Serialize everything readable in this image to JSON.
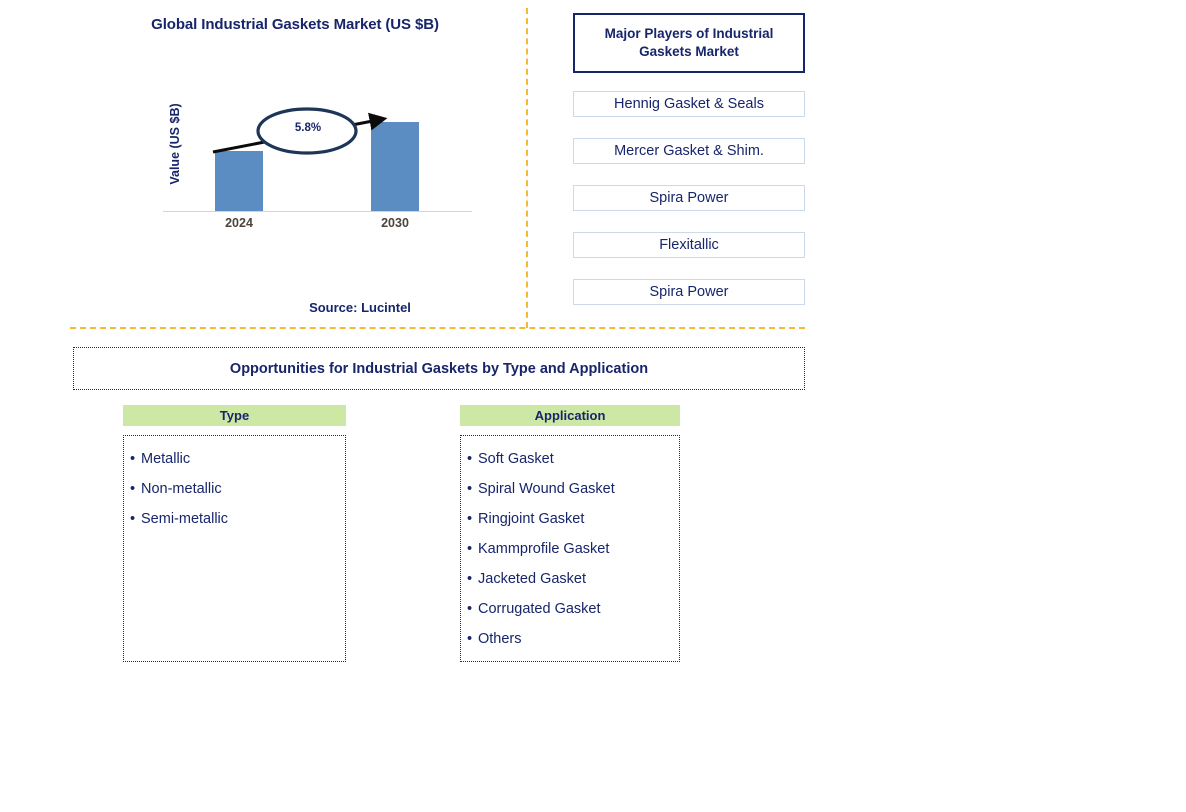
{
  "chart_panel": {
    "title": "Global Industrial Gaskets Market (US $B)",
    "ylabel": "Value (US $B)",
    "cagr_label": "5.8%",
    "source": "Source: Lucintel"
  },
  "chart_data": {
    "type": "bar",
    "title": "Global Industrial Gaskets Market (US $B)",
    "categories": [
      "2024",
      "2030"
    ],
    "values": [
      60,
      89
    ],
    "xlabel": "",
    "ylabel": "Value (US $B)",
    "ylim": [
      0,
      100
    ],
    "grid": false,
    "legend": "none",
    "annotations": [
      {
        "text": "5.8%",
        "kind": "cagr-callout-ellipse",
        "from": "2024",
        "to": "2030"
      }
    ],
    "series_color": "#5b8cc2",
    "note": "Bar heights are relative pixel readings; no numeric value labels are printed on the chart."
  },
  "players_panel": {
    "header": "Major Players of Industrial Gaskets Market",
    "items": [
      "Hennig Gasket & Seals",
      "Mercer Gasket & Shim.",
      "Spira Power",
      "Flexitallic",
      "Spira Power"
    ]
  },
  "opportunities": {
    "banner": "Opportunities for Industrial Gaskets by Type and Application",
    "columns": [
      {
        "header": "Type",
        "items": [
          "Metallic",
          "Non-metallic",
          "Semi-metallic"
        ]
      },
      {
        "header": "Application",
        "items": [
          "Soft Gasket",
          "Spiral Wound Gasket",
          "Ringjoint Gasket",
          "Kammprofile Gasket",
          "Jacketed Gasket",
          "Corrugated Gasket",
          "Others"
        ]
      }
    ]
  },
  "bullet_glyph": "•",
  "colors": {
    "navy": "#17256b",
    "bar_blue": "#5b8cc2",
    "divider_orange": "#f5b932",
    "header_green": "#cde8a5",
    "player_border": "#cbd9ea",
    "tick_label": "#4c443c"
  }
}
